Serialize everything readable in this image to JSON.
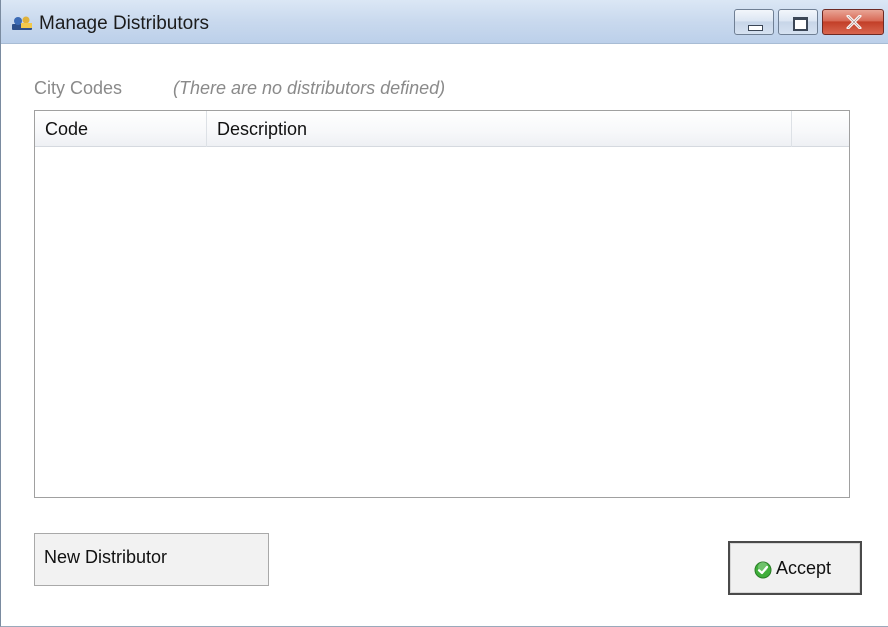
{
  "window": {
    "title": "Manage Distributors",
    "icon": "distributor-app-icon"
  },
  "controls": {
    "minimize_icon": "minimize-icon",
    "maximize_icon": "maximize-icon",
    "close_icon": "close-icon"
  },
  "section": {
    "label": "City Codes",
    "hint": "(There are no distributors defined)"
  },
  "grid": {
    "columns": [
      "Code",
      "Description",
      ""
    ],
    "rows": []
  },
  "buttons": {
    "new_distributor": "New Distributor",
    "accept": "Accept",
    "accept_icon": "check-circle-icon"
  },
  "colors": {
    "accept_icon_green": "#3fae3a",
    "close_red": "#c94a36",
    "muted_text": "#8a8a8a"
  }
}
